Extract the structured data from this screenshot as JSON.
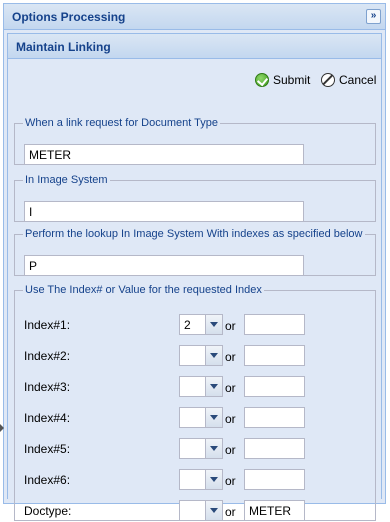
{
  "panel": {
    "title": "Options Processing",
    "collapse_glyph": "»"
  },
  "form": {
    "title": "Maintain Linking",
    "submit_label": "Submit",
    "cancel_label": "Cancel",
    "doc_type": {
      "legend": "When a link request for Document Type",
      "value": "METER"
    },
    "image_system": {
      "legend": "In Image System",
      "value": "I"
    },
    "lookup": {
      "legend": "Perform the lookup In Image System With indexes as specified below",
      "value": "P"
    },
    "indexes": {
      "legend": "Use The Index# or Value for the requested Index",
      "or_label": "or",
      "rows": [
        {
          "label": "Index#1:",
          "index": "2",
          "value": ""
        },
        {
          "label": "Index#2:",
          "index": "",
          "value": ""
        },
        {
          "label": "Index#3:",
          "index": "",
          "value": ""
        },
        {
          "label": "Index#4:",
          "index": "",
          "value": ""
        },
        {
          "label": "Index#5:",
          "index": "",
          "value": ""
        },
        {
          "label": "Index#6:",
          "index": "",
          "value": ""
        },
        {
          "label": "Doctype:",
          "index": "",
          "value": "METER"
        }
      ]
    }
  },
  "icons": {
    "submit": "check-circle-icon",
    "cancel": "cancel-circle-icon",
    "collapse": "double-chevron-right-icon",
    "dropdown": "chevron-down-icon"
  },
  "colors": {
    "header_text": "#15428b",
    "panel_bg": "#dfe8f6",
    "border": "#99bbe8"
  }
}
